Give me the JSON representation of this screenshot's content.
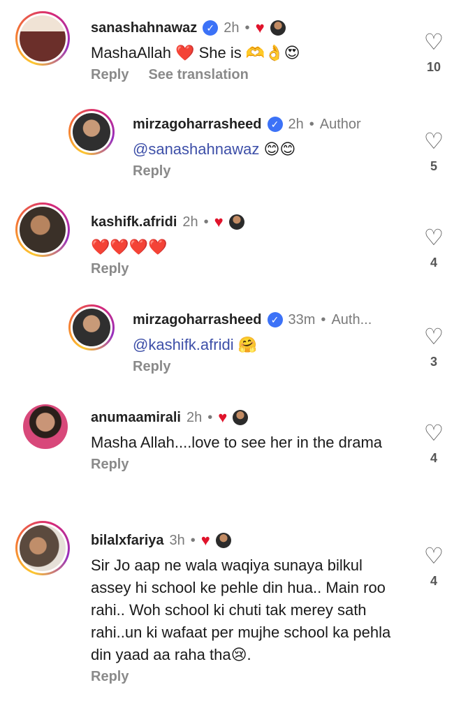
{
  "comments": [
    {
      "username": "sanashahnawaz",
      "time": "2h",
      "text": "MashaAllah ❤️ She is 🫶👌😍",
      "reply_label": "Reply",
      "translate_label": "See translation",
      "likes": "10"
    },
    {
      "username": "mirzagoharrasheed",
      "time": "2h",
      "author_label": "Author",
      "mention": "@sanashahnawaz",
      "text": "😊😊",
      "reply_label": "Reply",
      "likes": "5"
    },
    {
      "username": "kashifk.afridi",
      "time": "2h",
      "text": "❤️❤️❤️❤️",
      "reply_label": "Reply",
      "likes": "4"
    },
    {
      "username": "mirzagoharrasheed",
      "time": "33m",
      "author_label": "Auth...",
      "mention": "@kashifk.afridi",
      "text": "🤗",
      "reply_label": "Reply",
      "likes": "3"
    },
    {
      "username": "anumaamirali",
      "time": "2h",
      "text": "Masha Allah....love to see her in the drama",
      "reply_label": "Reply",
      "likes": "4"
    },
    {
      "username": "bilalxfariya",
      "time": "3h",
      "text": "Sir Jo aap ne wala waqiya sunaya bilkul assey hi school ke pehle din hua.. Main roo rahi.. Woh school ki chuti tak merey sath rahi..un ki wafaat per mujhe school ka pehla din yaad aa raha tha😢.",
      "reply_label": "Reply",
      "likes": "4"
    }
  ],
  "colors": {
    "mention": "#3d4fa8",
    "verified": "#3c72f7",
    "liked_heart": "#e0132b",
    "meta": "#7a7a7a"
  },
  "icons": [
    "heart-outline-icon",
    "verified-badge-icon",
    "liked-by-author-heart-icon"
  ]
}
